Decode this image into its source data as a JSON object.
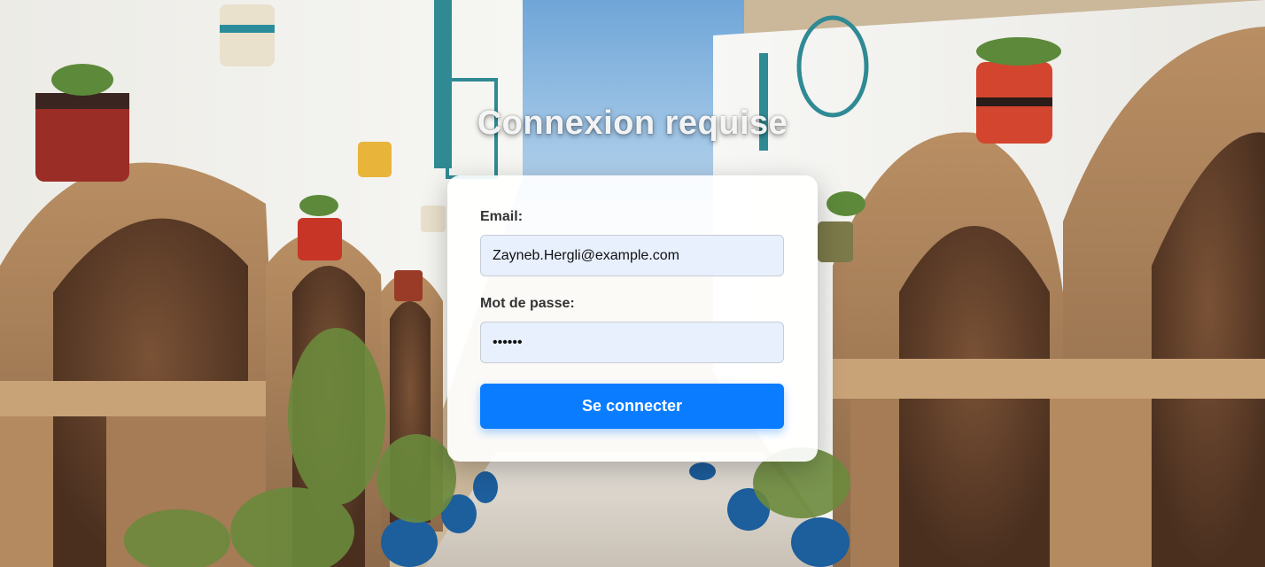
{
  "page": {
    "title": "Connexion requise"
  },
  "form": {
    "email_label": "Email:",
    "email_value": "Zayneb.Hergli@example.com",
    "password_label": "Mot de passe:",
    "password_value": "••••••",
    "submit_label": "Se connecter"
  },
  "colors": {
    "accent": "#0a7cff",
    "input_bg": "#e8f0fe",
    "card_bg": "#ffffff"
  },
  "background": {
    "description_icon": "photo-background"
  }
}
